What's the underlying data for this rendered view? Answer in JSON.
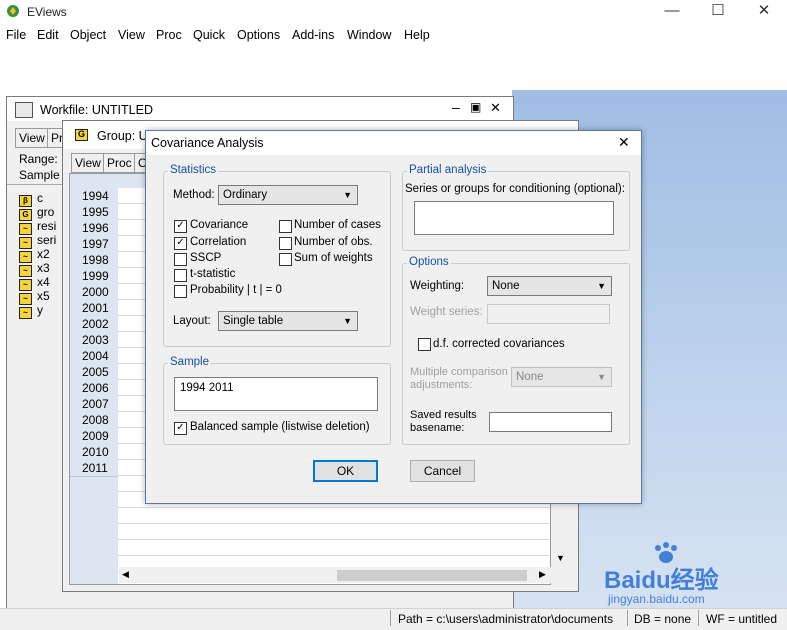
{
  "app": {
    "title": "EViews"
  },
  "menu": [
    "File",
    "Edit",
    "Object",
    "View",
    "Proc",
    "Quick",
    "Options",
    "Add-ins",
    "Window",
    "Help"
  ],
  "workfile": {
    "title": "Workfile: UNTITLED",
    "view_btn": "View",
    "pr_btn": "Pr",
    "range_label": "Range:",
    "sample_label": "Sample",
    "objects": [
      {
        "icon": "β",
        "name": "c"
      },
      {
        "icon": "G",
        "name": "gro"
      },
      {
        "icon": "~",
        "name": "resi"
      },
      {
        "icon": "~",
        "name": "seri"
      },
      {
        "icon": "~",
        "name": "x2"
      },
      {
        "icon": "~",
        "name": "x3"
      },
      {
        "icon": "~",
        "name": "x4"
      },
      {
        "icon": "~",
        "name": "x5"
      },
      {
        "icon": "~",
        "name": "y"
      }
    ]
  },
  "group": {
    "title": "Group: U",
    "view_btn": "View",
    "proc_btn": "Proc",
    "obj_btn": "O",
    "years": [
      "1994",
      "1995",
      "1996",
      "1997",
      "1998",
      "1999",
      "2000",
      "2001",
      "2002",
      "2003",
      "2004",
      "2005",
      "2006",
      "2007",
      "2008",
      "2009",
      "2010",
      "2011"
    ]
  },
  "dialog": {
    "title": "Covariance Analysis",
    "statistics": {
      "legend": "Statistics",
      "method_label": "Method:",
      "method_value": "Ordinary",
      "checks_left": [
        {
          "label": "Covariance",
          "checked": true
        },
        {
          "label": "Correlation",
          "checked": true
        },
        {
          "label": "SSCP",
          "checked": false
        },
        {
          "label": "t-statistic",
          "checked": false
        },
        {
          "label": "Probability | t | = 0",
          "checked": false
        }
      ],
      "checks_right": [
        {
          "label": "Number of cases",
          "checked": false
        },
        {
          "label": "Number of obs.",
          "checked": false
        },
        {
          "label": "Sum of weights",
          "checked": false
        }
      ],
      "layout_label": "Layout:",
      "layout_value": "Single table"
    },
    "sample": {
      "legend": "Sample",
      "value": "1994 2011",
      "balanced_label": "Balanced sample (listwise deletion)",
      "balanced_checked": true
    },
    "partial": {
      "legend": "Partial analysis",
      "series_label": "Series or groups for conditioning (optional):"
    },
    "options": {
      "legend": "Options",
      "weighting_label": "Weighting:",
      "weighting_value": "None",
      "weight_series_label": "Weight series:",
      "df_label": "d.f. corrected covariances",
      "multi_label_1": "Multiple comparison",
      "multi_label_2": "adjustments:",
      "multi_value": "None",
      "saved_label_1": "Saved results",
      "saved_label_2": "basename:"
    },
    "ok": "OK",
    "cancel": "Cancel"
  },
  "status": {
    "path": "Path = c:\\users\\administrator\\documents",
    "db": "DB = none",
    "wf": "WF = untitled"
  },
  "watermark": {
    "main": "Baidu经验",
    "sub": "jingyan.baidu.com"
  }
}
